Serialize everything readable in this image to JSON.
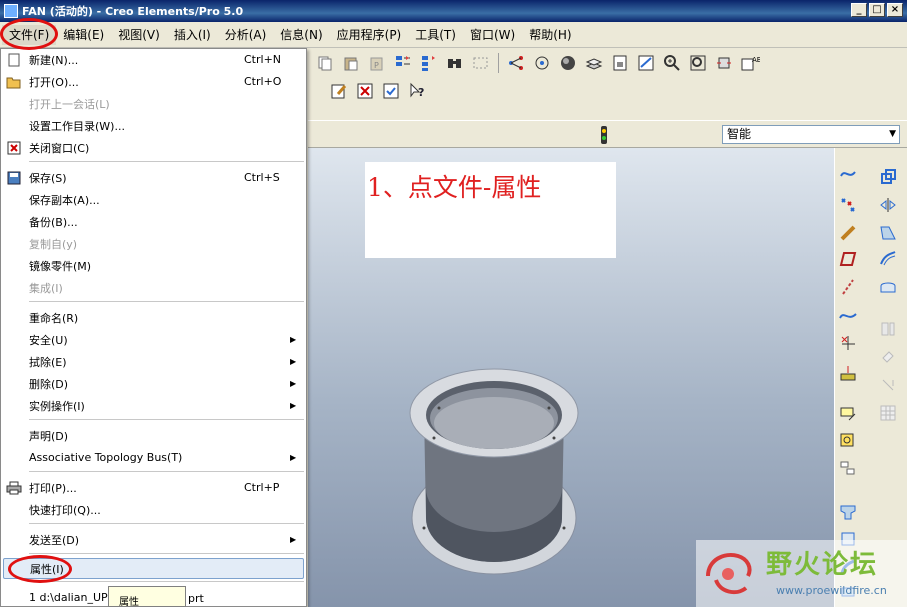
{
  "window": {
    "title": "FAN (活动的) - Creo Elements/Pro 5.0",
    "buttons": [
      "_",
      "□",
      "×"
    ]
  },
  "menubar": {
    "items": [
      {
        "label": "文件(F)",
        "active": true
      },
      {
        "label": "编辑(E)"
      },
      {
        "label": "视图(V)"
      },
      {
        "label": "插入(I)"
      },
      {
        "label": "分析(A)"
      },
      {
        "label": "信息(N)"
      },
      {
        "label": "应用程序(P)"
      },
      {
        "label": "工具(T)"
      },
      {
        "label": "窗口(W)"
      },
      {
        "label": "帮助(H)"
      }
    ]
  },
  "file_menu": {
    "items": [
      {
        "label": "新建(N)...",
        "shortcut": "Ctrl+N",
        "icon": "new-file-icon"
      },
      {
        "label": "打开(O)...",
        "shortcut": "Ctrl+O",
        "icon": "open-folder-icon"
      },
      {
        "label": "打开上一会话(L)",
        "disabled": true
      },
      {
        "label": "设置工作目录(W)..."
      },
      {
        "label": "关闭窗口(C)",
        "icon": "close-window-icon"
      },
      {
        "label": "保存(S)",
        "shortcut": "Ctrl+S",
        "icon": "save-icon"
      },
      {
        "label": "保存副本(A)..."
      },
      {
        "label": "备份(B)..."
      },
      {
        "label": "复制自(y)",
        "disabled": true
      },
      {
        "label": "镜像零件(M)"
      },
      {
        "label": "集成(I)",
        "disabled": true
      },
      {
        "label": "重命名(R)"
      },
      {
        "label": "安全(U)",
        "submenu": true
      },
      {
        "label": "拭除(E)",
        "submenu": true
      },
      {
        "label": "删除(D)",
        "submenu": true
      },
      {
        "label": "实例操作(I)",
        "submenu": true
      },
      {
        "label": "声明(D)"
      },
      {
        "label": "Associative Topology Bus(T)",
        "submenu": true
      },
      {
        "label": "打印(P)...",
        "shortcut": "Ctrl+P",
        "icon": "print-icon"
      },
      {
        "label": "快速打印(Q)..."
      },
      {
        "label": "发送至(D)",
        "submenu": true
      },
      {
        "label": "属性(I)",
        "highlighted": true
      },
      {
        "label": "1 d:\\dalian_UPS",
        "suffix": "prt"
      }
    ]
  },
  "tooltip": "属性",
  "annotation": "1、点文件-属性",
  "filter": {
    "selected": "智能"
  },
  "watermark": {
    "title": "野火论坛",
    "url": "www.proewildfire.cn"
  },
  "colors": {
    "annotation_red": "#e02020",
    "highlight": "#e3ecf7",
    "title_bar": "#0a246a"
  }
}
